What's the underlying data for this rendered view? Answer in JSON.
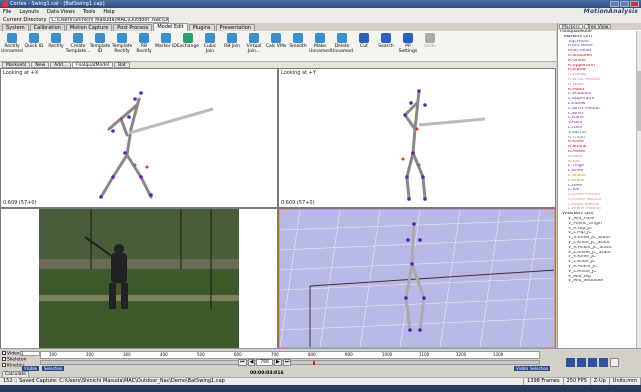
{
  "window": {
    "title": "Cortex - Swing1.cal - [BatSwing1.cap]",
    "brand": "MotionAnalysis"
  },
  "menu": [
    "File",
    "Layouts",
    "Data Views",
    "Tools",
    "Help"
  ],
  "dir": {
    "label": "Current Directory",
    "value": "C:\\Users\\Shinichi Masuda\\MAC\\Outdoor_Nac\\Demo"
  },
  "tabs": [
    "System",
    "Calibration",
    "Motion Capture",
    "Post Process",
    "Model Edit",
    "Plugins",
    "Presentation"
  ],
  "active_tab": "Model Edit",
  "toolbar": [
    {
      "label": "Rectify Unnamed",
      "icon": "rectify-icon",
      "color": "#3a8fd0"
    },
    {
      "label": "Quick ID",
      "icon": "quick-id-icon",
      "color": "#3a8fd0"
    },
    {
      "label": "Rectify",
      "icon": "rectify-icon",
      "color": "#3a8fd0"
    },
    {
      "label": "Create Template...",
      "icon": "create-template-icon",
      "color": "#3a8fd0"
    },
    {
      "label": "Template ID",
      "icon": "template-id-icon",
      "color": "#3a8fd0"
    },
    {
      "label": "Template Rectify",
      "icon": "template-rectify-icon",
      "color": "#3a8fd0"
    },
    {
      "label": "RB Rectify",
      "icon": "rb-rectify-icon",
      "color": "#3a8fd0"
    },
    {
      "label": "Marker ID",
      "icon": "marker-id-icon",
      "color": "#3a8fd0"
    },
    {
      "label": "Exchange",
      "icon": "exchange-icon",
      "color": "#2aa070"
    },
    {
      "label": "Cubic Join",
      "icon": "cubic-join-icon",
      "color": "#3a8fd0"
    },
    {
      "label": "RB Join",
      "icon": "rb-join-icon",
      "color": "#3a8fd0"
    },
    {
      "label": "Virtual Join...",
      "icon": "virtual-join-icon",
      "color": "#3a8fd0"
    },
    {
      "label": "Calc VMs",
      "icon": "calc-vms-icon",
      "color": "#3a8fd0"
    },
    {
      "label": "Smooth",
      "icon": "smooth-icon",
      "color": "#3a8fd0"
    },
    {
      "label": "Make Unnamed",
      "icon": "make-unnamed-icon",
      "color": "#3a8fd0"
    },
    {
      "label": "Delete Unnamed",
      "icon": "delete-unnamed-icon",
      "color": "#3a8fd0"
    },
    {
      "label": "Cut",
      "icon": "cut-icon",
      "color": "#2a60c0"
    },
    {
      "label": "Search",
      "icon": "search-icon",
      "color": "#2a60c0"
    },
    {
      "label": "PP Settings",
      "icon": "pp-settings-icon",
      "color": "#2a60c0"
    },
    {
      "label": "Undo",
      "icon": "undo-icon",
      "color": "#aaaaaa",
      "disabled": true
    }
  ],
  "subtabs": [
    "Marksets",
    "New",
    "Add...",
    "FoolquatModel",
    "Bat"
  ],
  "viewports": {
    "v1": {
      "label": "Looking at +X",
      "footer": "0.609 (57+0)"
    },
    "v2": {
      "label": "Looking at +Y",
      "footer": "0.609 (57+0)"
    }
  },
  "right_panel": {
    "tabs": [
      "Markers",
      "Tree View"
    ],
    "tree_root": "FoolquatMode",
    "markers_header": "Markers (37)",
    "markers": [
      {
        "n": "Top.Head",
        "c": "mk"
      },
      {
        "n": "Front.Head",
        "c": "mk"
      },
      {
        "n": "Rear.Head",
        "c": "mk"
      },
      {
        "n": "R.Shoulder",
        "c": "mk red"
      },
      {
        "n": "R.Offset",
        "c": "mk red"
      },
      {
        "n": "R.Upperarm",
        "c": "mk red"
      },
      {
        "n": "R.Elbow",
        "c": "mk red"
      },
      {
        "n": "R.Elbow",
        "c": "mk pink"
      },
      {
        "n": "R.Wrist Medial",
        "c": "mk pink"
      },
      {
        "n": "R.Wrist",
        "c": "mk pink"
      },
      {
        "n": "R.Hand",
        "c": "mk red"
      },
      {
        "n": "L.Shoulder",
        "c": "mk"
      },
      {
        "n": "L.Upperarm",
        "c": "mk"
      },
      {
        "n": "L.Elbow",
        "c": "mk"
      },
      {
        "n": "L.Wrist Medial",
        "c": "mk"
      },
      {
        "n": "L.Wrist",
        "c": "mk"
      },
      {
        "n": "L.Hand",
        "c": "mk"
      },
      {
        "n": "V.ASIS",
        "c": "mk"
      },
      {
        "n": "L.ASIS",
        "c": "mk"
      },
      {
        "n": "V.Sacral",
        "c": "mk"
      },
      {
        "n": "R.Thigh",
        "c": "mk grn"
      },
      {
        "n": "R.Knee",
        "c": "mk red"
      },
      {
        "n": "R.Shank",
        "c": "mk red"
      },
      {
        "n": "R.Ankle",
        "c": "mk red"
      },
      {
        "n": "R.Heel",
        "c": "mk org"
      },
      {
        "n": "R.Toe",
        "c": "mk org"
      },
      {
        "n": "L.Thigh",
        "c": "mk"
      },
      {
        "n": "L.Knee",
        "c": "mk"
      },
      {
        "n": "L.Shank",
        "c": "mk ylw"
      },
      {
        "n": "L.Ankle",
        "c": "mk ylw"
      },
      {
        "n": "L.Heel",
        "c": "mk"
      },
      {
        "n": "L.Toe",
        "c": "mk"
      },
      {
        "n": "R.Knee Medial",
        "c": "mk org"
      },
      {
        "n": "R.Ankle Medial",
        "c": "mk org"
      },
      {
        "n": "L.Knee Medial",
        "c": "mk org"
      },
      {
        "n": "L.Ankle Medial",
        "c": "mk org"
      }
    ],
    "vmarkers_header": "VMarkers (20)",
    "vmarkers": [
      "V_Mid_ASIS",
      "V_Pelvis_Origin",
      "V_R.Hip_JC",
      "V_L.Hip_JC",
      "V_R.Knee_JC_Static",
      "V_L.Knee_JC_Static",
      "V_R.Ankle_JC_Static",
      "V_L.Ankle_JC_Static",
      "V_R.Knee_JC",
      "V_L.Knee_JC",
      "V_R.Ankle_JC",
      "V_L.Ankle_JC",
      "V_Mid_Hip",
      "V_Mid_Shoulder"
    ]
  },
  "timeline": {
    "checks": [
      "Video",
      "Skeleton",
      "Kinetics"
    ],
    "calc_label": "Calculate",
    "start_frame": "1",
    "end_frame": "1398",
    "current_frame": "766",
    "ticks": [
      "100",
      "200",
      "300",
      "400",
      "500",
      "600",
      "700",
      "800",
      "900",
      "1000",
      "1100",
      "1200",
      "1300"
    ],
    "visible_label": "Visible",
    "selection_label": "Selection",
    "timecode": "00:00:03:016"
  },
  "status": {
    "msg": "152 :: Saved Capture: C:\\Users\\Shinichi Masuda\\MAC\\Outdoor_Nac\\Demo\\BatSwing1.cap",
    "frames": "1398 Frames",
    "fps": "250 FPS",
    "zup": "Z-Up",
    "units": "Units:mm"
  }
}
